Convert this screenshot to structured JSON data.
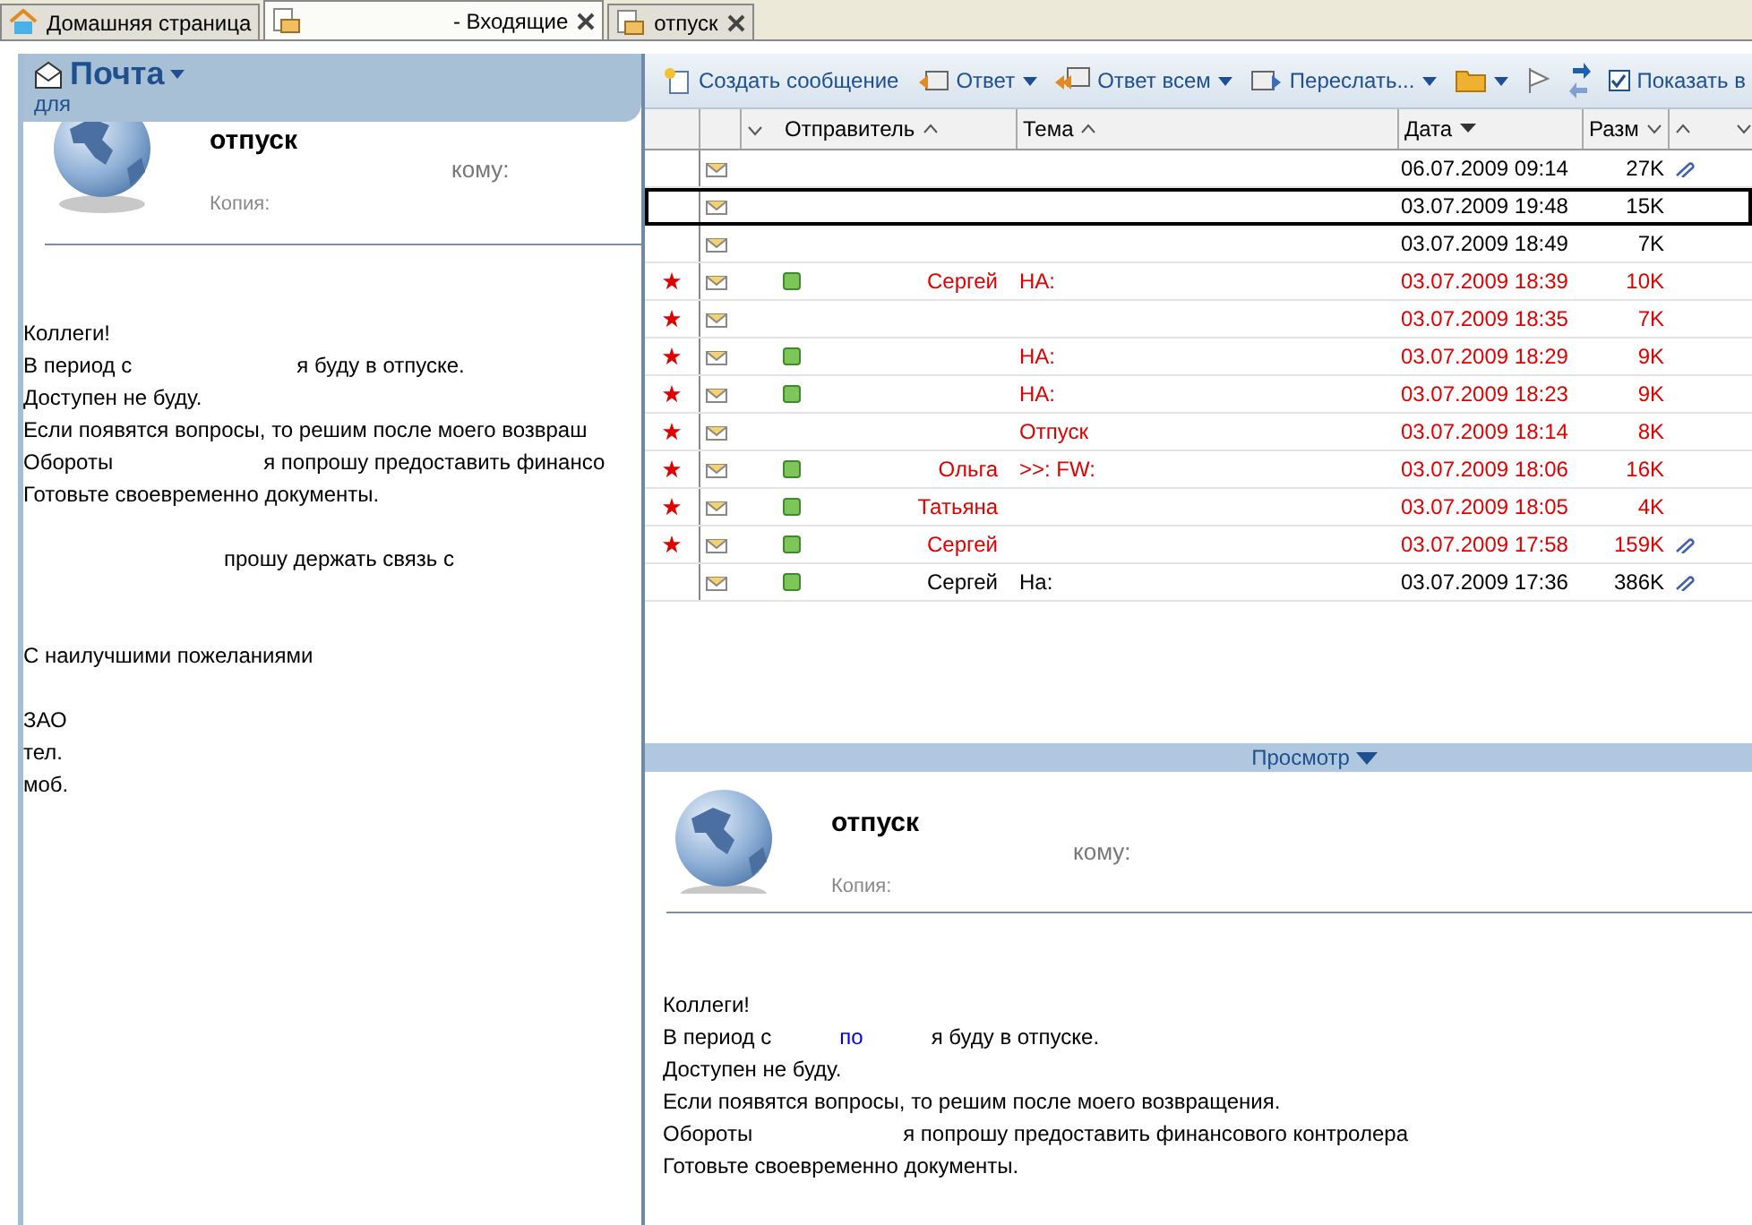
{
  "tabs": [
    {
      "label": "Домашняя страница",
      "selected": false
    },
    {
      "label": "- Входящие",
      "selected": true
    },
    {
      "label": "отпуск",
      "selected": false
    }
  ],
  "left_panel": {
    "title": "Почта",
    "subtitle": "для",
    "message": {
      "subject": "отпуск",
      "to_label": "кому:",
      "cc_label": "Копия:",
      "body": [
        {
          "lines": [
            [
              {
                "text": "Коллеги!",
                "kind": "text"
              }
            ],
            [
              {
                "text": "В период с",
                "kind": "text"
              },
              {
                "text": "я буду в отпуске.",
                "kind": "text"
              }
            ],
            [
              {
                "text": "Доступен не буду.",
                "kind": "text"
              }
            ],
            [
              {
                "text": "Если появятся вопросы, то решим после моего возвраш",
                "kind": "text"
              }
            ],
            [
              {
                "text": "Обороты",
                "kind": "text"
              },
              {
                "text": "я попрошу предоставить финансо",
                "kind": "text"
              }
            ],
            [
              {
                "text": "Готовьте своевременно документы.",
                "kind": "text"
              }
            ]
          ]
        },
        {
          "lines": [
            [
              {
                "text": "прошу держать связь с",
                "kind": "text"
              }
            ]
          ]
        },
        {
          "lines": [
            [
              {
                "text": "С наилучшими пожеланиями",
                "kind": "text"
              }
            ]
          ]
        },
        {
          "lines": [
            [
              {
                "text": "ЗАО",
                "kind": "text"
              }
            ],
            [
              {
                "text": "тел.",
                "kind": "text"
              }
            ],
            [
              {
                "text": "моб.",
                "kind": "text"
              }
            ]
          ]
        }
      ]
    }
  },
  "toolbar": [
    {
      "kind": "button",
      "label": "Создать сообщение",
      "dropdown": false
    },
    {
      "kind": "button",
      "label": "Ответ",
      "dropdown": true
    },
    {
      "kind": "button",
      "label": "Ответ всем",
      "dropdown": true
    },
    {
      "kind": "button",
      "label": "Переслать...",
      "dropdown": true
    },
    {
      "kind": "icon",
      "dropdown": true
    },
    {
      "kind": "icon",
      "dropdown": false
    },
    {
      "kind": "icon",
      "dropdown": false
    },
    {
      "kind": "checkbox",
      "label": "Показать в",
      "checked": true
    }
  ],
  "table": {
    "columns": [
      {
        "label": "Отправитель"
      },
      {
        "label": "Тема"
      },
      {
        "label": "Дата"
      },
      {
        "label": "Разм"
      }
    ],
    "rows": [
      {
        "flagged": false,
        "presence": false,
        "sender": "",
        "subject": "",
        "date": "06.07.2009 09:14",
        "size": "27K",
        "attachment": true,
        "selected": false
      },
      {
        "flagged": false,
        "presence": false,
        "sender": "",
        "subject": "",
        "date": "03.07.2009 19:48",
        "size": "15K",
        "attachment": false,
        "selected": true
      },
      {
        "flagged": false,
        "presence": false,
        "sender": "",
        "subject": "",
        "date": "03.07.2009 18:49",
        "size": "7K",
        "attachment": false,
        "selected": false
      },
      {
        "flagged": true,
        "presence": true,
        "sender": "Сергей",
        "subject": "НА:",
        "date": "03.07.2009 18:39",
        "size": "10K",
        "attachment": false,
        "selected": false
      },
      {
        "flagged": true,
        "presence": false,
        "sender": "",
        "subject": "",
        "date": "03.07.2009 18:35",
        "size": "7K",
        "attachment": false,
        "selected": false
      },
      {
        "flagged": true,
        "presence": true,
        "sender": "",
        "subject": "НА:",
        "date": "03.07.2009 18:29",
        "size": "9K",
        "attachment": false,
        "selected": false
      },
      {
        "flagged": true,
        "presence": true,
        "sender": "",
        "subject": "НА:",
        "date": "03.07.2009 18:23",
        "size": "9K",
        "attachment": false,
        "selected": false
      },
      {
        "flagged": true,
        "presence": false,
        "sender": "",
        "subject": "Отпуск",
        "date": "03.07.2009 18:14",
        "size": "8K",
        "attachment": false,
        "selected": false
      },
      {
        "flagged": true,
        "presence": true,
        "sender": "Ольга",
        "subject": ">>: FW:",
        "date": "03.07.2009 18:06",
        "size": "16K",
        "attachment": false,
        "selected": false
      },
      {
        "flagged": true,
        "presence": true,
        "sender": "Татьяна",
        "subject": "",
        "date": "03.07.2009 18:05",
        "size": "4K",
        "attachment": false,
        "selected": false
      },
      {
        "flagged": true,
        "presence": true,
        "sender": "Сергей",
        "subject": "",
        "date": "03.07.2009 17:58",
        "size": "159K",
        "attachment": true,
        "selected": false
      },
      {
        "flagged": false,
        "presence": true,
        "sender": "Сергей",
        "subject": "На:",
        "date": "03.07.2009 17:36",
        "size": "386K",
        "attachment": true,
        "selected": false
      }
    ]
  },
  "preview_bar": {
    "label": "Просмотр"
  },
  "preview": {
    "subject": "отпуск",
    "to_label": "кому:",
    "cc_label": "Копия:",
    "body": [
      {
        "lines": [
          [
            {
              "text": "Коллеги!",
              "kind": "text"
            }
          ],
          [
            {
              "text": "В период с",
              "kind": "text"
            },
            {
              "text": "по",
              "kind": "link"
            },
            {
              "text": "я буду в отпуске.",
              "kind": "text"
            }
          ],
          [
            {
              "text": "Доступен не буду.",
              "kind": "text"
            }
          ],
          [
            {
              "text": "Если появятся вопросы, то решим после моего возвращения.",
              "kind": "text"
            }
          ],
          [
            {
              "text": "Обороты",
              "kind": "text"
            },
            {
              "text": "я попрошу предоставить финансового контролера",
              "kind": "text"
            }
          ],
          [
            {
              "text": "Готовьте своевременно документы.",
              "kind": "text"
            }
          ]
        ]
      }
    ]
  }
}
